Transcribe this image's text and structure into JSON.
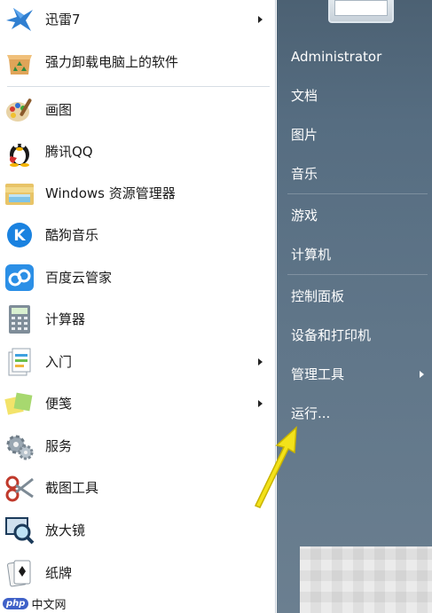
{
  "programs": [
    {
      "label": "迅雷7",
      "icon": "thunder-icon",
      "submenu": true
    },
    {
      "label": "强力卸载电脑上的软件",
      "icon": "uninstall-box-icon",
      "submenu": false
    },
    {
      "label": "画图",
      "icon": "paint-palette-icon",
      "submenu": false
    },
    {
      "label": "腾讯QQ",
      "icon": "qq-penguin-icon",
      "submenu": false
    },
    {
      "label": "Windows 资源管理器",
      "icon": "explorer-folder-icon",
      "submenu": false
    },
    {
      "label": "酷狗音乐",
      "icon": "kugou-icon",
      "submenu": false
    },
    {
      "label": "百度云管家",
      "icon": "baidu-cloud-icon",
      "submenu": false
    },
    {
      "label": "计算器",
      "icon": "calculator-icon",
      "submenu": false
    },
    {
      "label": "入门",
      "icon": "getting-started-icon",
      "submenu": true
    },
    {
      "label": "便笺",
      "icon": "sticky-notes-icon",
      "submenu": true
    },
    {
      "label": "服务",
      "icon": "services-gear-icon",
      "submenu": false
    },
    {
      "label": "截图工具",
      "icon": "snipping-tool-icon",
      "submenu": false
    },
    {
      "label": "放大镜",
      "icon": "magnifier-icon",
      "submenu": false
    },
    {
      "label": "纸牌",
      "icon": "solitaire-cards-icon",
      "submenu": false
    }
  ],
  "right_menu": [
    {
      "label": "Administrator",
      "submenu": false
    },
    {
      "label": "文档",
      "submenu": false
    },
    {
      "label": "图片",
      "submenu": false
    },
    {
      "label": "音乐",
      "submenu": false
    },
    {
      "label": "游戏",
      "submenu": false
    },
    {
      "label": "计算机",
      "submenu": false
    },
    {
      "label": "控制面板",
      "submenu": false
    },
    {
      "label": "设备和打印机",
      "submenu": false
    },
    {
      "label": "管理工具",
      "submenu": true
    },
    {
      "label": "运行...",
      "submenu": false
    }
  ],
  "watermark": {
    "badge": "php",
    "site": "中文网"
  },
  "colors": {
    "panel_dark": "#566d81",
    "arrow_yellow": "#f3e21a"
  }
}
